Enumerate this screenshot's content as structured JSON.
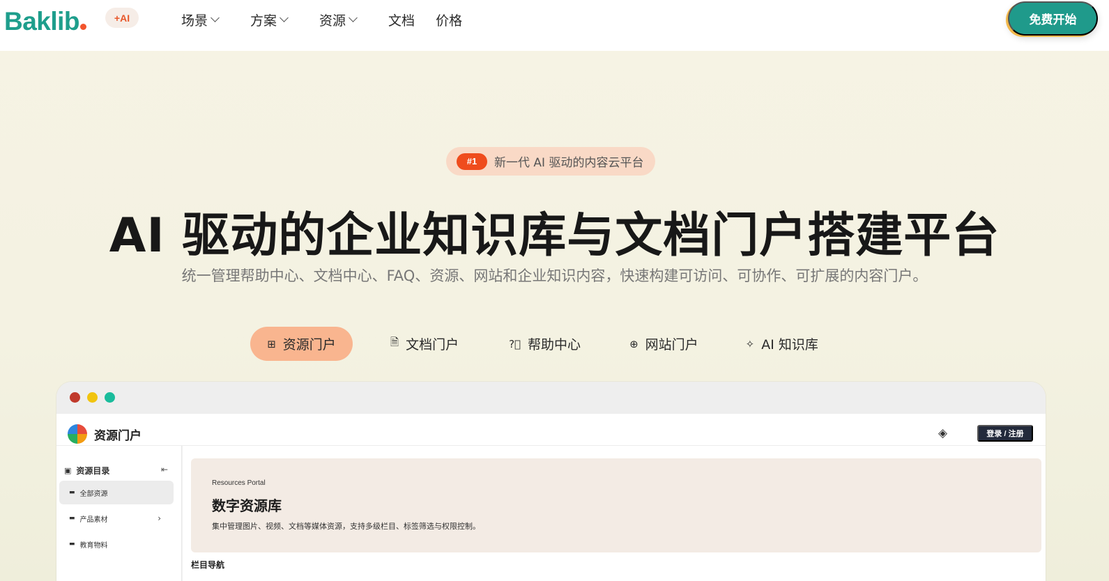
{
  "header": {
    "logo": "Baklib",
    "ai_badge": "+AI",
    "nav": [
      {
        "label": "场景",
        "has_dropdown": true
      },
      {
        "label": "方案",
        "has_dropdown": true
      },
      {
        "label": "资源",
        "has_dropdown": true
      },
      {
        "label": "文档",
        "has_dropdown": false
      },
      {
        "label": "价格",
        "has_dropdown": false
      }
    ],
    "cta_label": "免费开始"
  },
  "hero": {
    "badge_rank": "#1",
    "badge_text": "新一代 AI 驱动的内容云平台",
    "title": "AI 驱动的企业知识库与文档门户搭建平台",
    "subtitle": "统一管理帮助中心、文档中心、FAQ、资源、网站和企业知识内容，快速构建可访问、可协作、可扩展的内容门户。"
  },
  "tabs": [
    {
      "label": "资源门户",
      "icon": "plus-square-icon",
      "active": true
    },
    {
      "label": "文档门户",
      "icon": "document-icon",
      "active": false
    },
    {
      "label": "帮助中心",
      "icon": "help-circle-icon",
      "active": false
    },
    {
      "label": "网站门户",
      "icon": "globe-icon",
      "active": false
    },
    {
      "label": "AI 知识库",
      "icon": "sparkle-icon",
      "active": false
    }
  ],
  "preview": {
    "portal_title": "资源门户",
    "login_label": "登录 / 注册",
    "sidebar": {
      "heading": "资源目录",
      "items": [
        {
          "label": "全部资源",
          "active": true
        },
        {
          "label": "产品素材",
          "has_children": true
        },
        {
          "label": "教育物料"
        }
      ]
    },
    "banner": {
      "eyebrow": "Resources Portal",
      "title": "数字资源库",
      "description": "集中管理图片、视频、文档等媒体资源，支持多级栏目、标签筛选与权限控制。"
    },
    "section_label": "栏目导航"
  },
  "colors": {
    "brand": "#1e9e8c",
    "accent": "#ef4c1d",
    "active_tab": "#f9b58f",
    "cta": "#1f9a8b"
  }
}
